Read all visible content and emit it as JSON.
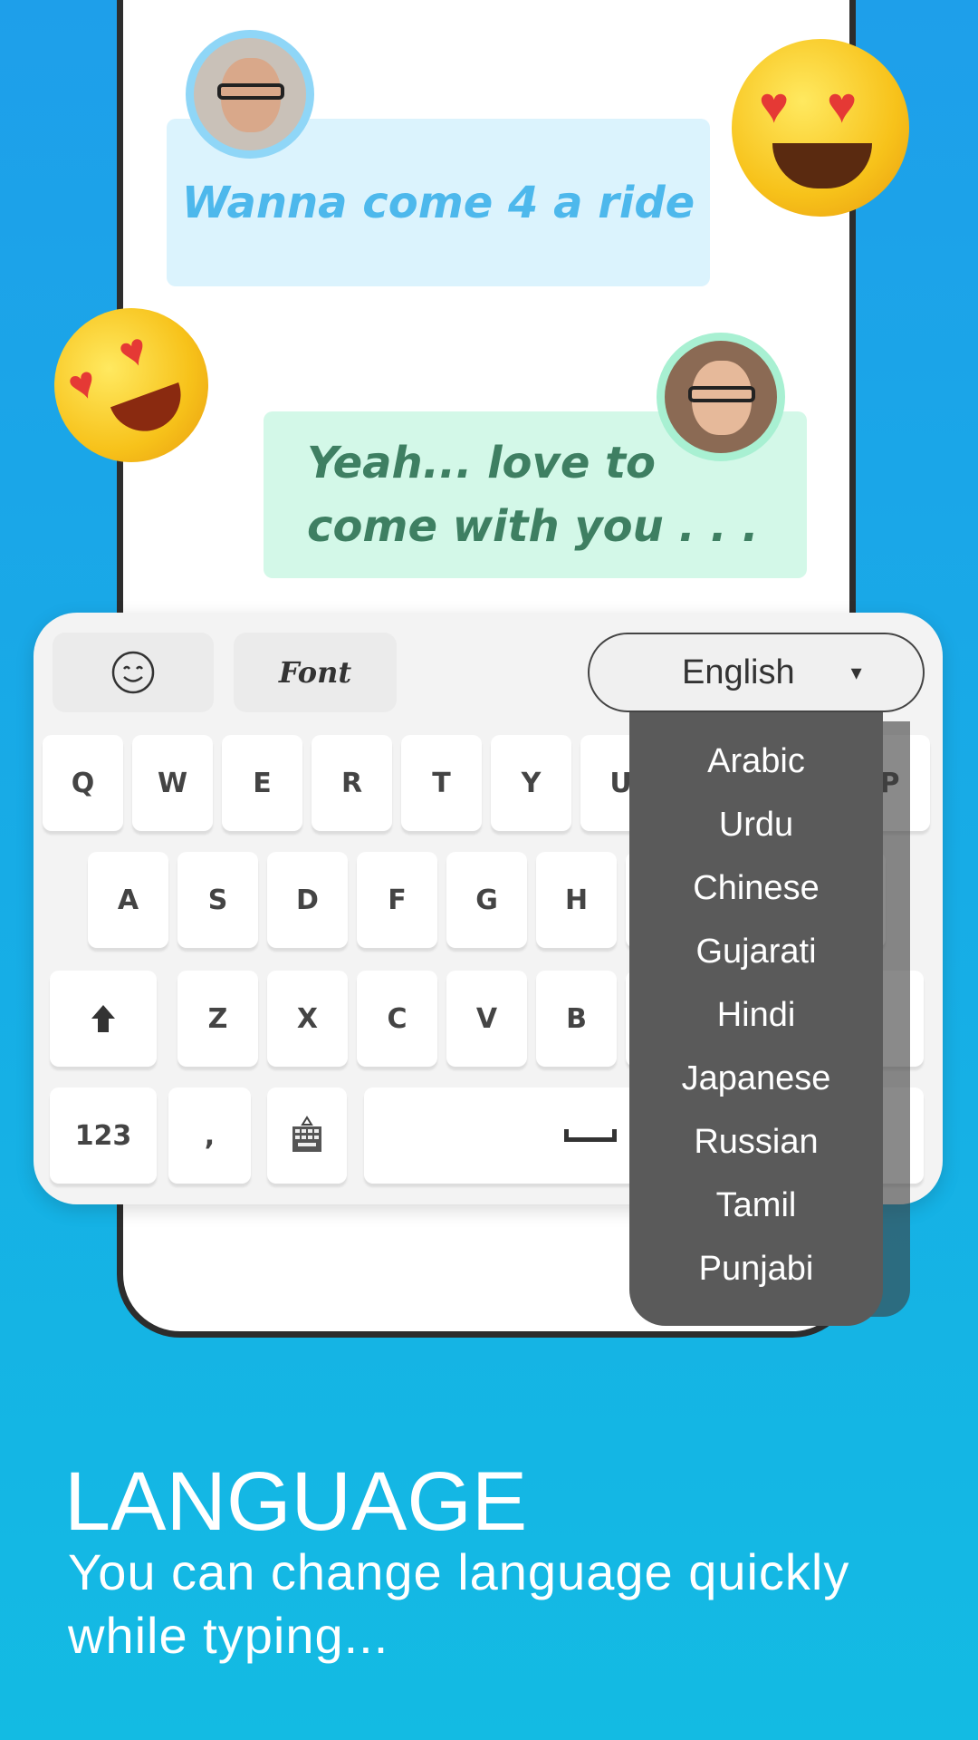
{
  "chat": {
    "message_1": "Wanna come 4 a ride",
    "message_2_line1": "Yeah... love to",
    "message_2_line2": "come with you . . ."
  },
  "toolbar": {
    "emoji_icon": "smiley-icon",
    "font_label": "Font",
    "language_selected": "English",
    "dropdown_arrow": "▾"
  },
  "language_menu": [
    "Arabic",
    "Urdu",
    "Chinese",
    "Gujarati",
    "Hindi",
    "Japanese",
    "Russian",
    "Tamil",
    "Punjabi"
  ],
  "keys": {
    "row1": [
      "Q",
      "W",
      "E",
      "R",
      "T",
      "Y",
      "U",
      "",
      "",
      "P"
    ],
    "row2": [
      "A",
      "S",
      "D",
      "F",
      "G",
      "H",
      "",
      "",
      ""
    ],
    "row3": [
      "Z",
      "X",
      "C",
      "V",
      "B",
      "",
      ""
    ],
    "numbers": "123",
    "comma": ","
  },
  "promo": {
    "title": "LANGUAGE",
    "subtitle_line1": "You can change language quickly",
    "subtitle_line2": "while typing..."
  },
  "colors": {
    "background": "#17ace6",
    "bubble_blue": "#dbf3fd",
    "bubble_green": "#d3f8e8",
    "menu": "#5a5a5a"
  }
}
